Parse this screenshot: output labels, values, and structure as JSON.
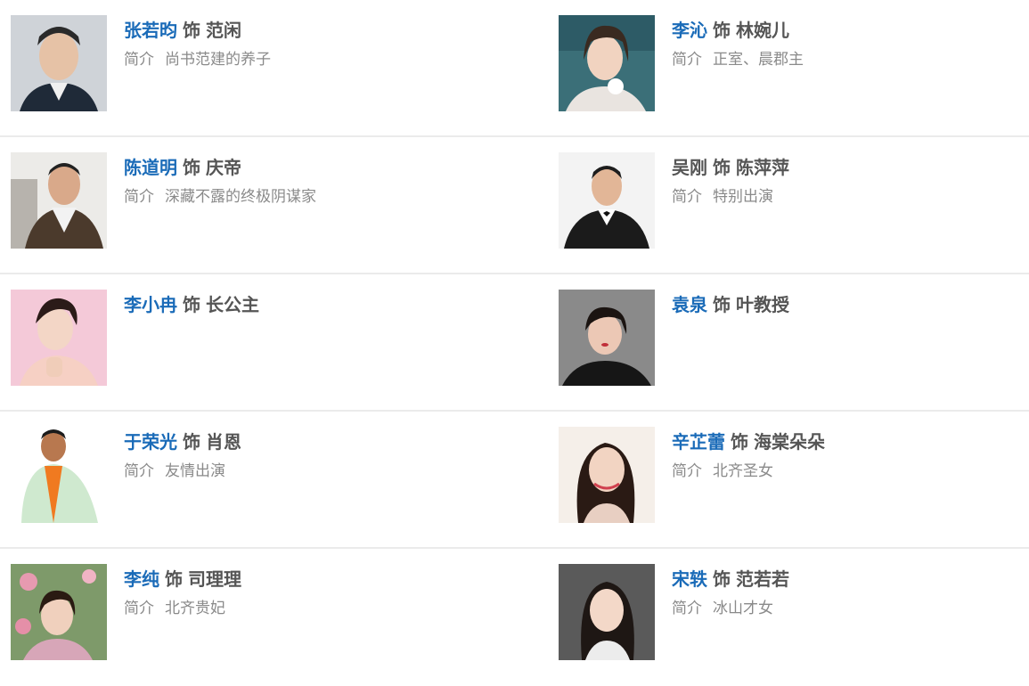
{
  "colors": {
    "actor_link": "#1a6bb8",
    "text_dark": "#555555",
    "text_muted": "#8a8a8a",
    "divider": "#ebebeb"
  },
  "labels": {
    "as_word": "饰",
    "intro_label": "简介"
  },
  "rows": [
    {
      "left": {
        "actor": "张若昀",
        "role": "范闲",
        "intro": "尚书范建的养子",
        "photo": "actor-photo"
      },
      "right": {
        "actor": "李沁",
        "role": "林婉儿",
        "intro": "正室、晨郡主",
        "photo": "actor-photo"
      }
    },
    {
      "left": {
        "actor": "陈道明",
        "role": "庆帝",
        "intro": "深藏不露的终极阴谋家",
        "photo": "actor-photo"
      },
      "right": {
        "actor": "吴刚",
        "role": "陈萍萍",
        "intro": "特别出演",
        "photo": "actor-photo"
      }
    },
    {
      "left": {
        "actor": "李小冉",
        "role": "长公主",
        "intro": "",
        "photo": "actor-photo"
      },
      "right": {
        "actor": "袁泉",
        "role": "叶教授",
        "intro": "",
        "photo": "actor-photo"
      }
    },
    {
      "left": {
        "actor": "于荣光",
        "role": "肖恩",
        "intro": "友情出演",
        "photo": "actor-photo"
      },
      "right": {
        "actor": "辛芷蕾",
        "role": "海棠朵朵",
        "intro": "北齐圣女",
        "photo": "actor-photo"
      }
    },
    {
      "left": {
        "actor": "李纯",
        "role": "司理理",
        "intro": "北齐贵妃",
        "photo": "actor-photo"
      },
      "right": {
        "actor": "宋轶",
        "role": "范若若",
        "intro": "冰山才女",
        "photo": "actor-photo"
      }
    }
  ]
}
